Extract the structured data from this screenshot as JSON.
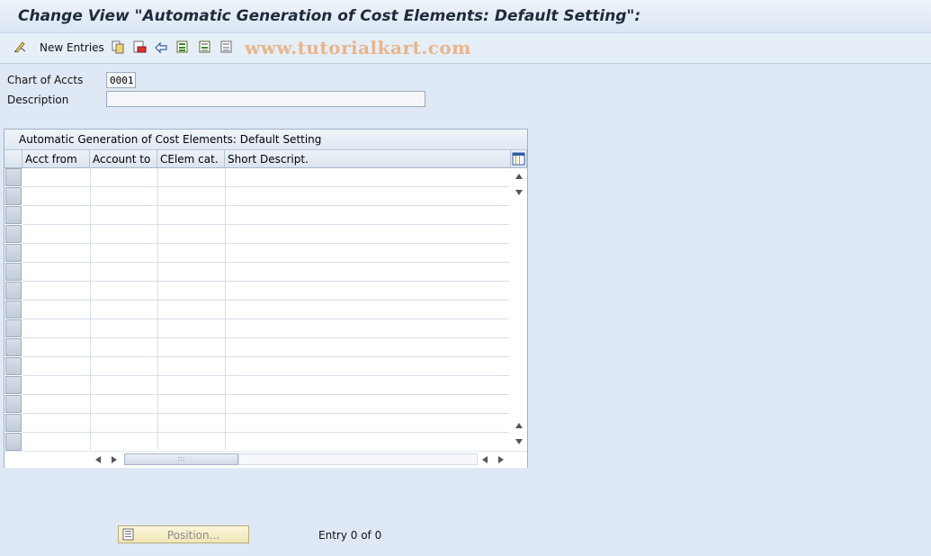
{
  "window": {
    "title": "Change View \"Automatic Generation of Cost Elements: Default Setting\":"
  },
  "toolbar": {
    "new_entries_label": "New Entries",
    "watermark": "www.tutorialkart.com",
    "icons": [
      "edit-pencil-icon",
      "copy-icon",
      "delete-icon",
      "undo-icon",
      "select-all-icon",
      "select-block-icon",
      "deselect-all-icon"
    ]
  },
  "fields": {
    "chart_of_accts_label": "Chart of Accts",
    "chart_of_accts_value": "0001",
    "description_label": "Description",
    "description_value": ""
  },
  "table": {
    "title": "Automatic Generation of Cost Elements: Default Setting",
    "columns": [
      "Acct from",
      "Account to",
      "CElem cat.",
      "Short Descript."
    ],
    "row_count": 15
  },
  "footer": {
    "position_button_label": "Position...",
    "entry_info": "Entry 0 of 0"
  },
  "colors": {
    "background": "#dfe9f5",
    "title_text": "#1f2b3c",
    "watermark": "#e8b58b",
    "position_button": "#f1e6b5"
  }
}
